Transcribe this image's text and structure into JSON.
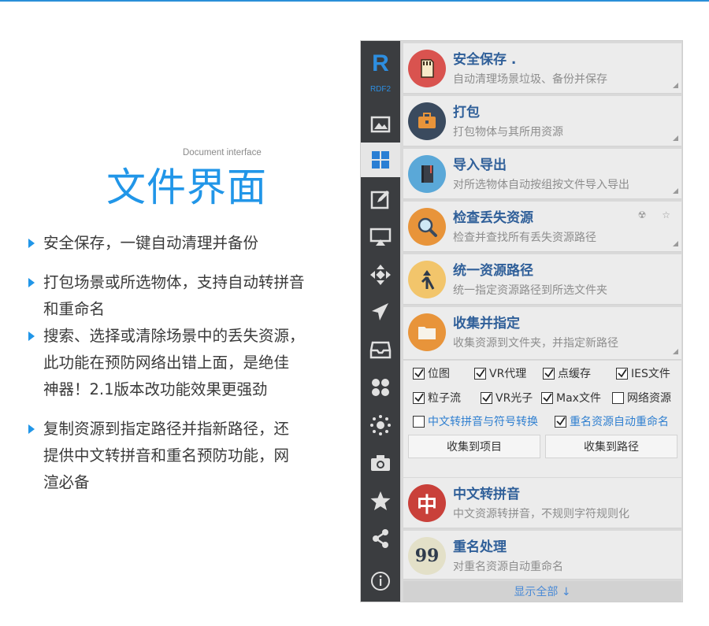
{
  "colors": {
    "accent": "#2196e8",
    "sidebar": "#3b3d40",
    "card_title": "#2f5f99"
  },
  "description": {
    "subtitle_en": "Document interface",
    "title": "文件界面",
    "bullets": [
      {
        "lines": [
          "安全保存，一键自动清理并备份"
        ]
      },
      {
        "lines": [
          "打包场景或所选物体，支持自动转拼音",
          "和重命名"
        ]
      },
      {
        "lines": [
          "搜索、选择或清除场景中的丢失资源，",
          "此功能在预防网络出错上面，是绝佳",
          "神器！2.1版本改功能效果更强劲"
        ]
      },
      {
        "lines": [
          "复制资源到指定路径并指新路径，还",
          "提供中文转拼音和重名预防功能，网",
          "渲必备"
        ]
      }
    ]
  },
  "sidebar": {
    "logo": "R",
    "logo_sub": "RDF2",
    "items": [
      {
        "icon": "image-icon"
      },
      {
        "icon": "grid-icon",
        "active": true
      },
      {
        "icon": "edit-icon"
      },
      {
        "icon": "display-icon"
      },
      {
        "icon": "move-icon"
      },
      {
        "icon": "plane-icon"
      },
      {
        "icon": "tray-icon"
      },
      {
        "icon": "dots-icon"
      },
      {
        "icon": "sun-icon"
      },
      {
        "icon": "camera-icon"
      },
      {
        "icon": "star-icon"
      },
      {
        "icon": "share-icon"
      },
      {
        "icon": "info-icon"
      }
    ]
  },
  "cards": [
    {
      "title": "安全保存 .",
      "subtitle": "自动清理场景垃圾、备份并保存",
      "icon": "sd-card-icon",
      "color": "#d9534f"
    },
    {
      "title": "打包",
      "subtitle": "打包物体与其所用资源",
      "icon": "briefcase-icon",
      "color": "#3a4a5e"
    },
    {
      "title": "导入导出",
      "subtitle": "对所选物体自动按组按文件导入导出",
      "icon": "notebook-icon",
      "color": "#5aa8d8"
    },
    {
      "title": "检查丢失资源",
      "subtitle": "检查并查找所有丢失资源路径",
      "icon": "magnifier-icon",
      "color": "#e8943a",
      "extra": "☢ ☆"
    },
    {
      "title": "统一资源路径",
      "subtitle": "统一指定资源路径到所选文件夹",
      "icon": "path-icon",
      "color": "#f2c56b"
    },
    {
      "title": "收集并指定",
      "subtitle": "收集资源到文件夹，并指定新路径",
      "icon": "folder-icon",
      "color": "#e8943a"
    },
    {
      "title": "中文转拼音",
      "subtitle": "中文资源转拼音，不规则字符规则化",
      "icon": "zhong-icon",
      "color": "#c9403a",
      "glyph": "中"
    },
    {
      "title": "重名处理",
      "subtitle": "对重名资源自动重命名",
      "icon": "quote-icon",
      "color": "#e3e0c8",
      "glyph": "99"
    }
  ],
  "options": {
    "checkboxes": [
      {
        "label": "位图",
        "checked": true
      },
      {
        "label": "VR代理",
        "checked": true
      },
      {
        "label": "点缓存",
        "checked": true
      },
      {
        "label": "IES文件",
        "checked": true
      },
      {
        "label": "粒子流",
        "checked": true
      },
      {
        "label": "VR光子",
        "checked": true
      },
      {
        "label": "Max文件",
        "checked": true
      },
      {
        "label": "网络资源",
        "checked": false
      },
      {
        "label": "中文转拼音与符号转换",
        "checked": false
      },
      {
        "label": "重名资源自动重命名",
        "checked": true
      }
    ],
    "collect_to_project": "收集到项目",
    "collect_to_path": "收集到路径"
  },
  "show_all": "显示全部 ↓"
}
